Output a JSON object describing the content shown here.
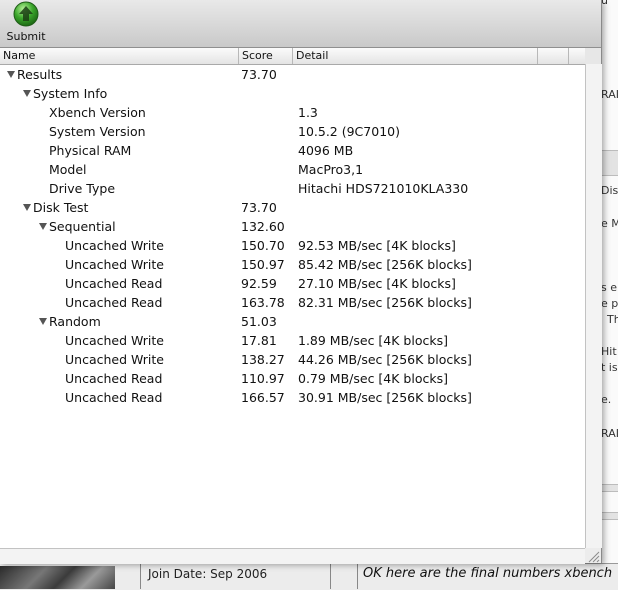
{
  "window": {
    "toolbar": {
      "submit_label": "Submit",
      "icon": "green-up-arrow-icon"
    },
    "columns": {
      "name": "Name",
      "score": "Score",
      "detail": "Detail"
    },
    "rows": [
      {
        "name": "Results",
        "score": "73.70",
        "detail": "",
        "level": 0,
        "expandable": true
      },
      {
        "name": "System Info",
        "score": "",
        "detail": "",
        "level": 1,
        "expandable": true
      },
      {
        "name": "Xbench Version",
        "score": "",
        "detail": "1.3",
        "level": 2,
        "expandable": false
      },
      {
        "name": "System Version",
        "score": "",
        "detail": "10.5.2 (9C7010)",
        "level": 2,
        "expandable": false
      },
      {
        "name": "Physical RAM",
        "score": "",
        "detail": "4096 MB",
        "level": 2,
        "expandable": false
      },
      {
        "name": "Model",
        "score": "",
        "detail": "MacPro3,1",
        "level": 2,
        "expandable": false
      },
      {
        "name": "Drive Type",
        "score": "",
        "detail": "Hitachi HDS721010KLA330",
        "level": 2,
        "expandable": false
      },
      {
        "name": "Disk Test",
        "score": "73.70",
        "detail": "",
        "level": 1,
        "expandable": true
      },
      {
        "name": "Sequential",
        "score": "132.60",
        "detail": "",
        "level": 2,
        "expandable": true
      },
      {
        "name": "Uncached Write",
        "score": "150.70",
        "detail": "92.53 MB/sec [4K blocks]",
        "level": 3,
        "expandable": false
      },
      {
        "name": "Uncached Write",
        "score": "150.97",
        "detail": "85.42 MB/sec [256K blocks]",
        "level": 3,
        "expandable": false
      },
      {
        "name": "Uncached Read",
        "score": "92.59",
        "detail": "27.10 MB/sec [4K blocks]",
        "level": 3,
        "expandable": false
      },
      {
        "name": "Uncached Read",
        "score": "163.78",
        "detail": "82.31 MB/sec [256K blocks]",
        "level": 3,
        "expandable": false
      },
      {
        "name": "Random",
        "score": "51.03",
        "detail": "",
        "level": 2,
        "expandable": true
      },
      {
        "name": "Uncached Write",
        "score": "17.81",
        "detail": "1.89 MB/sec [4K blocks]",
        "level": 3,
        "expandable": false
      },
      {
        "name": "Uncached Write",
        "score": "138.27",
        "detail": "44.26 MB/sec [256K blocks]",
        "level": 3,
        "expandable": false
      },
      {
        "name": "Uncached Read",
        "score": "110.97",
        "detail": "0.79 MB/sec [4K blocks]",
        "level": 3,
        "expandable": false
      },
      {
        "name": "Uncached Read",
        "score": "166.57",
        "detail": "30.91 MB/sec [256K blocks]",
        "level": 3,
        "expandable": false
      }
    ]
  },
  "background": {
    "right_fragments": [
      "u",
      "RAI",
      "Dis",
      "e M",
      "s e",
      "e p",
      "Th",
      "Hit",
      "t is",
      "e.",
      "RAI"
    ],
    "join_date": "Join Date: Sep 2006",
    "post_text": "OK here are the final numbers xbench"
  },
  "colors": {
    "toolbar": "#d6d6d6",
    "icon_green": "#3aa52a",
    "selection": "#ffffff"
  }
}
